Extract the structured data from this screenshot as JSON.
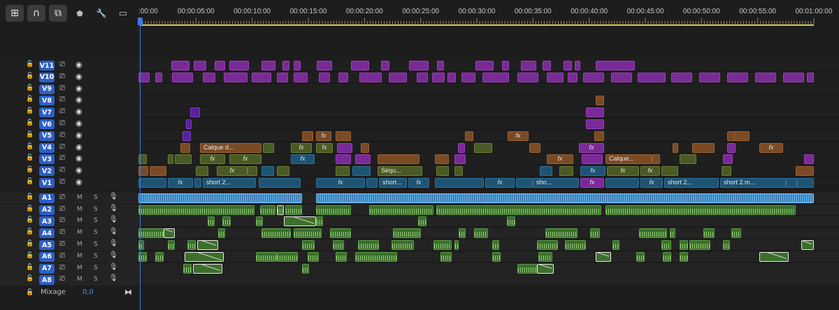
{
  "timeline": {
    "duration_seconds": 60,
    "ruler_labels": [
      ":00:00",
      "00:00:05:00",
      "00:00:10:00",
      "00:00:15:00",
      "00:00:20:00",
      "00:00:25:00",
      "00:00:30:00",
      "00:00:35:00",
      "00:00:40:00",
      "00:00:45:00",
      "00:00:50:00",
      "00:00:55:00",
      "00:01:00:00"
    ],
    "playhead_time": "00:00:00:00"
  },
  "toolbar": {
    "tools": [
      {
        "name": "insert-sequence-icon",
        "glyph": "⊞",
        "active": true
      },
      {
        "name": "snap-magnet-icon",
        "glyph": "∩",
        "active": true
      },
      {
        "name": "linked-selection-icon",
        "glyph": "⧉",
        "active": true
      },
      {
        "name": "add-marker-icon",
        "glyph": "⬟",
        "active": false
      },
      {
        "name": "timeline-settings-wrench-icon",
        "glyph": "🔧",
        "active": false
      },
      {
        "name": "captions-icon",
        "glyph": "▭",
        "active": false
      }
    ]
  },
  "video_tracks": [
    "V11",
    "V10",
    "V9",
    "V8",
    "V7",
    "V6",
    "V5",
    "V4",
    "V3",
    "V2",
    "V1"
  ],
  "audio_tracks": [
    "A1",
    "A2",
    "A3",
    "A4",
    "A5",
    "A6",
    "A7",
    "A8"
  ],
  "audio_controls": {
    "mute": "M",
    "solo": "S"
  },
  "mix": {
    "label": "Mixage",
    "value": "0,0"
  },
  "clip_labels": {
    "v4_calque": "Calque d...",
    "v3_calque": "Calque...",
    "v2_sequ": "Séqu...",
    "v1_short1": "short 2...",
    "v1_short2": "short...",
    "v1_short3": "sho...",
    "v1_short4": "short 2...",
    "v1_short5": "short 2.m...",
    "fx": "fx"
  }
}
